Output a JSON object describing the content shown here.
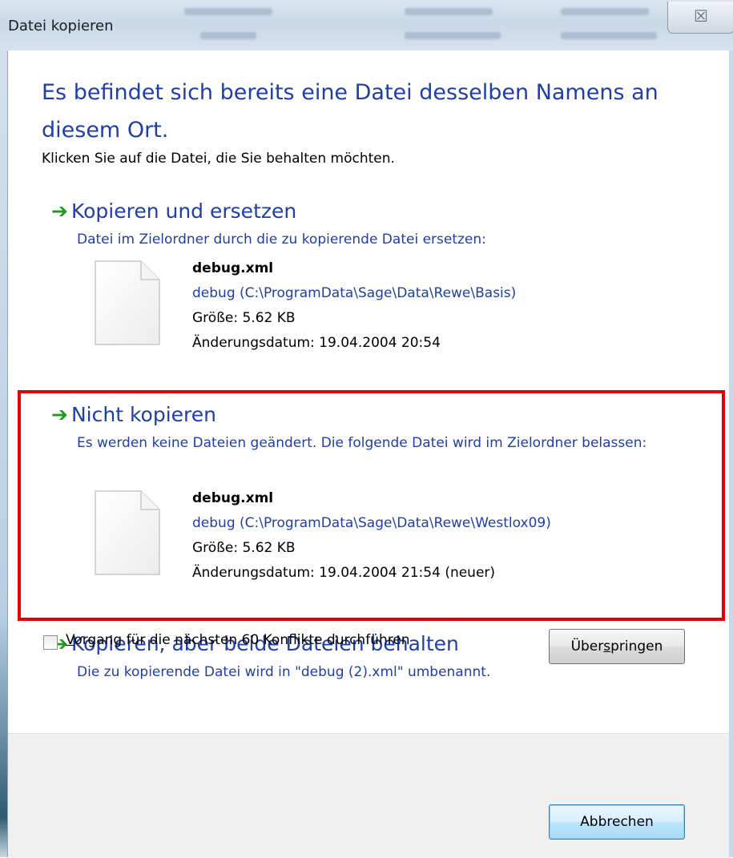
{
  "window": {
    "title": "Datei kopieren",
    "close_glyph": "☒"
  },
  "dialog": {
    "heading": "Es befindet sich bereits eine Datei desselben Namens an diesem Ort.",
    "subtitle": "Klicken Sie auf die Datei, die Sie behalten möchten."
  },
  "options": [
    {
      "title": "Kopieren und ersetzen",
      "description": "Datei im Zielordner durch die zu kopierende Datei ersetzen:",
      "file": {
        "name": "debug.xml",
        "path": "debug (C:\\ProgramData\\Sage\\Data\\Rewe\\Basis)",
        "size": "Größe: 5.62 KB",
        "modified": "Änderungsdatum: 19.04.2004 20:54"
      }
    },
    {
      "title": "Nicht kopieren",
      "description": "Es werden keine Dateien geändert. Die folgende Datei wird im Zielordner belassen:",
      "file": {
        "name": "debug.xml",
        "path": "debug (C:\\ProgramData\\Sage\\Data\\Rewe\\Westlox09)",
        "size": "Größe: 5.62 KB",
        "modified": "Änderungsdatum: 19.04.2004 21:54 (neuer)"
      },
      "highlighted": true
    },
    {
      "title": "Kopieren, aber beide Dateien behalten",
      "description": "Die zu kopierende Datei wird in \"debug (2).xml\" umbenannt."
    }
  ],
  "footer": {
    "checkbox_label_first": "V",
    "checkbox_label_rest": "organg für die nächsten 60 Konflikte durchführen",
    "checkbox_checked": false,
    "skip_button_pre": "Über",
    "skip_button_accel": "s",
    "skip_button_post": "pringen",
    "cancel_button": "Abbrechen"
  },
  "colors": {
    "link_blue": "#1e3fa8",
    "arrow_green": "#1b9a1b",
    "highlight_red": "#e20000"
  },
  "icons": {
    "option_arrow": "arrow-right-icon",
    "file": "document-icon"
  }
}
